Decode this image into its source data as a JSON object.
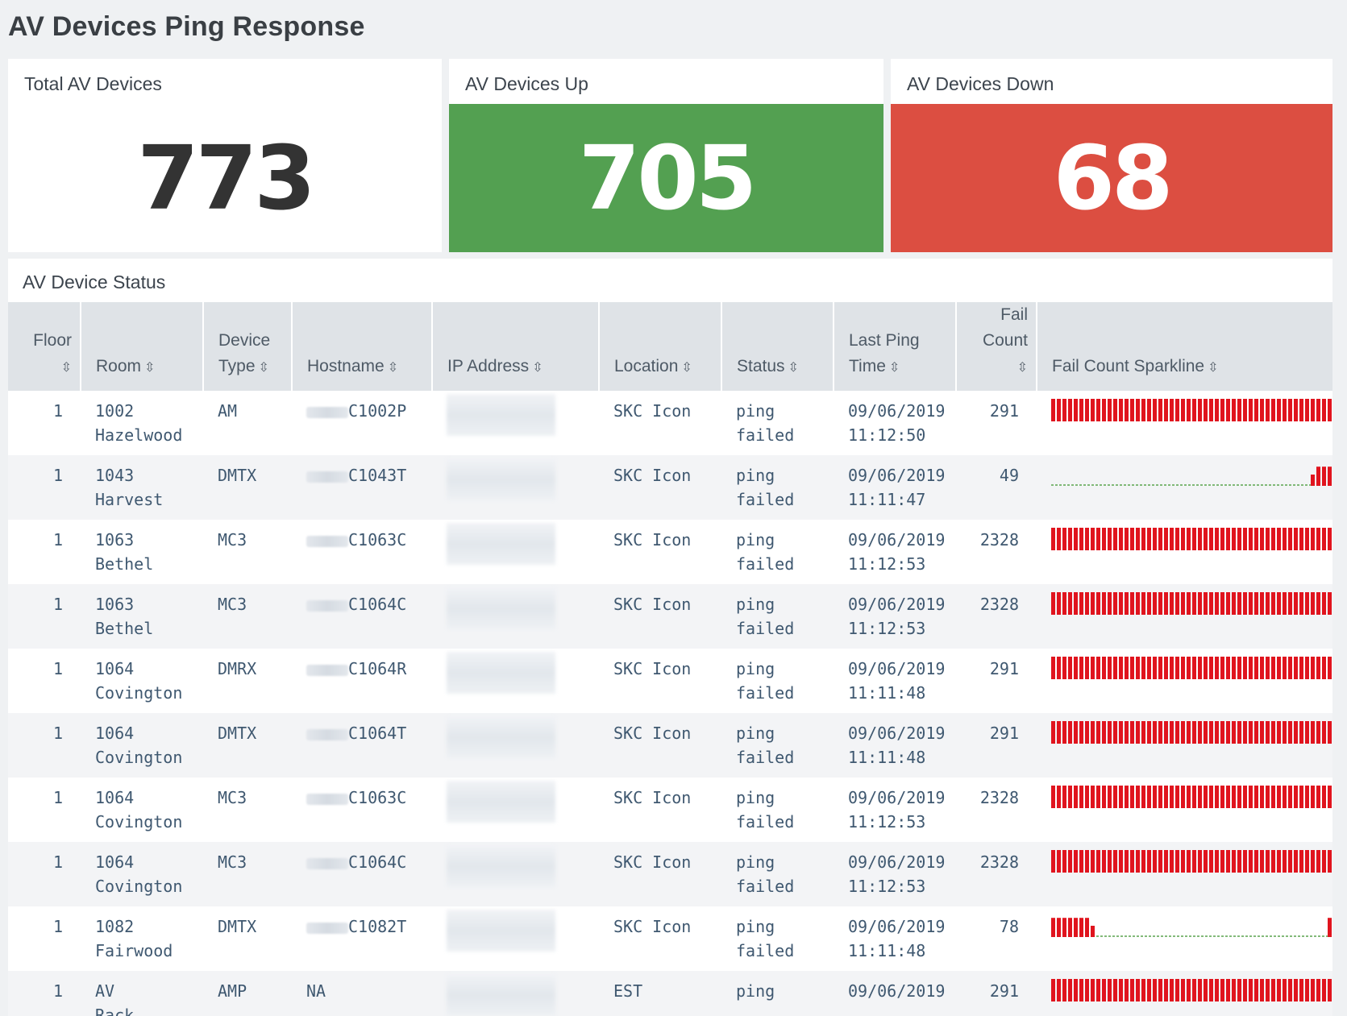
{
  "page": {
    "title": "AV Devices Ping Response"
  },
  "kpis": {
    "total": {
      "title": "Total AV Devices",
      "value": "773",
      "color": "#333333"
    },
    "up": {
      "title": "AV Devices Up",
      "value": "705",
      "color": "#53a051"
    },
    "down": {
      "title": "AV Devices Down",
      "value": "68",
      "color": "#dc4e41"
    }
  },
  "table": {
    "title": "AV Device Status",
    "columns": {
      "floor": "Floor",
      "room": "Room",
      "device_type": "Device Type",
      "hostname": "Hostname",
      "ip": "IP Address",
      "location": "Location",
      "status": "Status",
      "last_ping": "Last Ping Time",
      "fail_count": "Fail Count",
      "sparkline": "Fail Count Sparkline"
    },
    "sparkline_colors": {
      "bar": "#e0141e",
      "baseline": "#5aa34f"
    },
    "rows": [
      {
        "floor": "1",
        "room": "1002 Hazelwood",
        "device_type": "AM",
        "hostname": "C1002P",
        "location": "SKC Icon",
        "status": "ping failed",
        "last_ping": "09/06/2019 11:12:50",
        "fail_count": "291",
        "sparkline": {
          "type": "full"
        }
      },
      {
        "floor": "1",
        "room": "1043 Harvest",
        "device_type": "DMTX",
        "hostname": "C1043T",
        "location": "SKC Icon",
        "status": "ping failed",
        "last_ping": "09/06/2019 11:11:47",
        "fail_count": "49",
        "sparkline": {
          "type": "tail",
          "tail_bars": 4
        }
      },
      {
        "floor": "1",
        "room": "1063 Bethel",
        "device_type": "MC3",
        "hostname": "C1063C",
        "location": "SKC Icon",
        "status": "ping failed",
        "last_ping": "09/06/2019 11:12:53",
        "fail_count": "2328",
        "sparkline": {
          "type": "full"
        }
      },
      {
        "floor": "1",
        "room": "1063 Bethel",
        "device_type": "MC3",
        "hostname": "C1064C",
        "location": "SKC Icon",
        "status": "ping failed",
        "last_ping": "09/06/2019 11:12:53",
        "fail_count": "2328",
        "sparkline": {
          "type": "full"
        }
      },
      {
        "floor": "1",
        "room": "1064 Covington",
        "device_type": "DMRX",
        "hostname": "C1064R",
        "location": "SKC Icon",
        "status": "ping failed",
        "last_ping": "09/06/2019 11:11:48",
        "fail_count": "291",
        "sparkline": {
          "type": "full"
        }
      },
      {
        "floor": "1",
        "room": "1064 Covington",
        "device_type": "DMTX",
        "hostname": "C1064T",
        "location": "SKC Icon",
        "status": "ping failed",
        "last_ping": "09/06/2019 11:11:48",
        "fail_count": "291",
        "sparkline": {
          "type": "full"
        }
      },
      {
        "floor": "1",
        "room": "1064 Covington",
        "device_type": "MC3",
        "hostname": "C1063C",
        "location": "SKC Icon",
        "status": "ping failed",
        "last_ping": "09/06/2019 11:12:53",
        "fail_count": "2328",
        "sparkline": {
          "type": "full"
        }
      },
      {
        "floor": "1",
        "room": "1064 Covington",
        "device_type": "MC3",
        "hostname": "C1064C",
        "location": "SKC Icon",
        "status": "ping failed",
        "last_ping": "09/06/2019 11:12:53",
        "fail_count": "2328",
        "sparkline": {
          "type": "full"
        }
      },
      {
        "floor": "1",
        "room": "1082 Fairwood",
        "device_type": "DMTX",
        "hostname": "C1082T",
        "location": "SKC Icon",
        "status": "ping failed",
        "last_ping": "09/06/2019 11:11:48",
        "fail_count": "78",
        "sparkline": {
          "type": "head",
          "head_bars": 8,
          "tail_bars": 1
        }
      },
      {
        "floor": "1",
        "room": "AV Rack",
        "device_type": "AMP",
        "hostname": "NA",
        "location": "EST",
        "status": "ping",
        "last_ping": "09/06/2019",
        "fail_count": "291",
        "sparkline": {
          "type": "full"
        }
      }
    ]
  }
}
